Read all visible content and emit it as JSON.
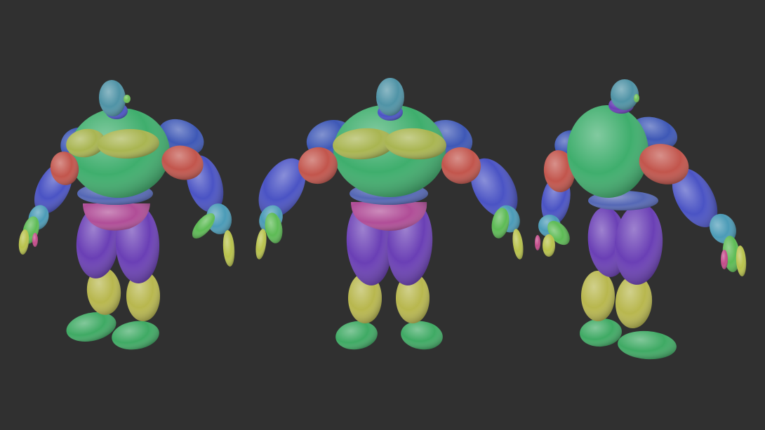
{
  "scene": {
    "background": "#303030",
    "border": "#ffffff",
    "views": [
      "three-quarter",
      "front",
      "back"
    ],
    "palette": {
      "head": "#4f93a6",
      "torso": "#3fae6d",
      "pecs": "#a9b551",
      "shoulder": "#3e58b6",
      "upper_arm": "#c2554c",
      "forearm": "#4a53c4",
      "wrist": "#4b9bb7",
      "belt": "#5467b5",
      "briefs": "#b04d97",
      "thigh": "#6a3fb5",
      "shin": "#b8b74e",
      "foot": "#3faa64",
      "hand": "#5dbb55",
      "finger_yellow": "#b8c24c",
      "finger_pink": "#c44b8a",
      "ear": "#6dbf55"
    }
  }
}
